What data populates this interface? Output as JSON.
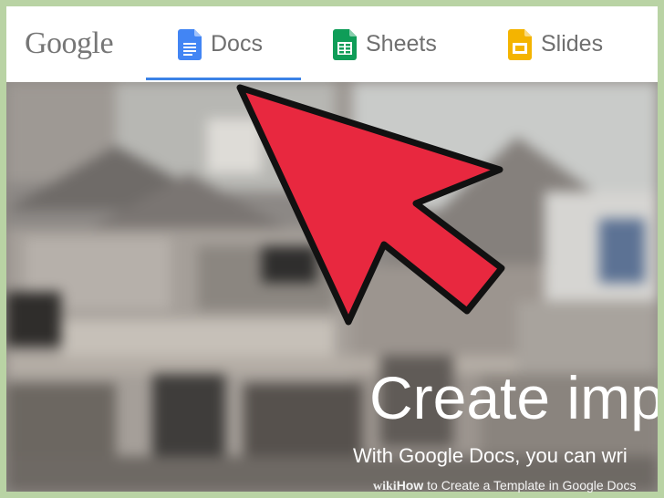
{
  "header": {
    "logo_text": "Google",
    "tabs": [
      {
        "label": "Docs",
        "icon": "docs-icon",
        "color": "#4285F4",
        "active": true
      },
      {
        "label": "Sheets",
        "icon": "sheets-icon",
        "color": "#0F9D58",
        "active": false
      },
      {
        "label": "Slides",
        "icon": "slides-icon",
        "color": "#F4B400",
        "active": false
      }
    ],
    "active_color": "#3B82E6"
  },
  "hero": {
    "headline": "Create imp",
    "subline": "With Google Docs, you can wri"
  },
  "annotation": {
    "icon": "pointer-arrow-icon",
    "color": "#E8283F"
  },
  "footer": {
    "brand": "wiki",
    "bold_word": "How",
    "rest": " to Create a Template in Google Docs"
  }
}
